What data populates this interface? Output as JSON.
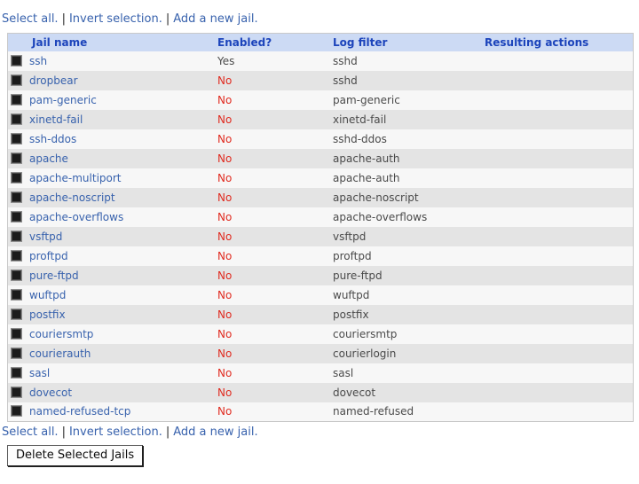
{
  "links": {
    "select_all": "Select all.",
    "separator": "|",
    "invert_selection": "Invert selection.",
    "add_new_jail": "Add a new jail."
  },
  "table": {
    "headers": [
      "Jail name",
      "Enabled?",
      "Log filter",
      "Resulting actions"
    ],
    "rows": [
      {
        "jail": "ssh",
        "enabled": "Yes",
        "filter": "sshd",
        "actions": ""
      },
      {
        "jail": "dropbear",
        "enabled": "No",
        "filter": "sshd",
        "actions": ""
      },
      {
        "jail": "pam-generic",
        "enabled": "No",
        "filter": "pam-generic",
        "actions": ""
      },
      {
        "jail": "xinetd-fail",
        "enabled": "No",
        "filter": "xinetd-fail",
        "actions": ""
      },
      {
        "jail": "ssh-ddos",
        "enabled": "No",
        "filter": "sshd-ddos",
        "actions": ""
      },
      {
        "jail": "apache",
        "enabled": "No",
        "filter": "apache-auth",
        "actions": ""
      },
      {
        "jail": "apache-multiport",
        "enabled": "No",
        "filter": "apache-auth",
        "actions": ""
      },
      {
        "jail": "apache-noscript",
        "enabled": "No",
        "filter": "apache-noscript",
        "actions": ""
      },
      {
        "jail": "apache-overflows",
        "enabled": "No",
        "filter": "apache-overflows",
        "actions": ""
      },
      {
        "jail": "vsftpd",
        "enabled": "No",
        "filter": "vsftpd",
        "actions": ""
      },
      {
        "jail": "proftpd",
        "enabled": "No",
        "filter": "proftpd",
        "actions": ""
      },
      {
        "jail": "pure-ftpd",
        "enabled": "No",
        "filter": "pure-ftpd",
        "actions": ""
      },
      {
        "jail": "wuftpd",
        "enabled": "No",
        "filter": "wuftpd",
        "actions": ""
      },
      {
        "jail": "postfix",
        "enabled": "No",
        "filter": "postfix",
        "actions": ""
      },
      {
        "jail": "couriersmtp",
        "enabled": "No",
        "filter": "couriersmtp",
        "actions": ""
      },
      {
        "jail": "courierauth",
        "enabled": "No",
        "filter": "courierlogin",
        "actions": ""
      },
      {
        "jail": "sasl",
        "enabled": "No",
        "filter": "sasl",
        "actions": ""
      },
      {
        "jail": "dovecot",
        "enabled": "No",
        "filter": "dovecot",
        "actions": ""
      },
      {
        "jail": "named-refused-tcp",
        "enabled": "No",
        "filter": "named-refused",
        "actions": ""
      }
    ]
  },
  "button": {
    "delete_label": "Delete Selected Jails"
  },
  "colors": {
    "header_bg": "#ccdaf4",
    "header_text": "#1c44bb",
    "link": "#3862ad",
    "no_red": "#e02b20",
    "row_odd": "#f7f7f7",
    "row_even": "#e4e4e4",
    "table_border": "#c9c9c9"
  }
}
